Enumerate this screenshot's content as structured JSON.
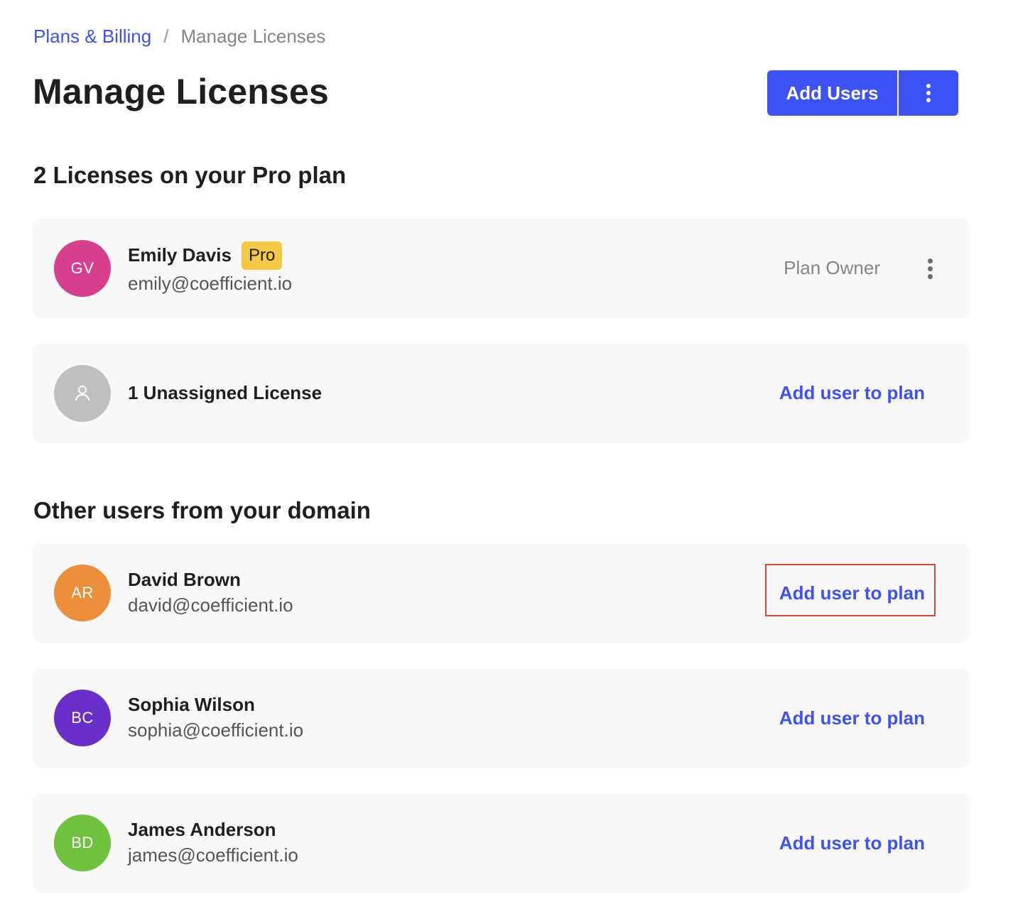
{
  "breadcrumb": {
    "parent": "Plans & Billing",
    "separator": "/",
    "current": "Manage Licenses"
  },
  "header": {
    "title": "Manage Licenses",
    "primary_button": "Add Users"
  },
  "licenses_section": {
    "title": "2 Licenses on your Pro plan",
    "owner": {
      "initials": "GV",
      "name": "Emily Davis",
      "badge": "Pro",
      "email": "emily@coefficient.io",
      "role": "Plan Owner",
      "avatar_color": "#d83f8c"
    },
    "unassigned": {
      "label": "1 Unassigned License",
      "action": "Add user to plan",
      "avatar_color": "#bfbfbf"
    }
  },
  "domain_section": {
    "title": "Other users from your domain",
    "users": [
      {
        "initials": "AR",
        "name": "David Brown",
        "email": "david@coefficient.io",
        "action": "Add user to plan",
        "avatar_color": "#ec8f3a"
      },
      {
        "initials": "BC",
        "name": "Sophia Wilson",
        "email": "sophia@coefficient.io",
        "action": "Add user to plan",
        "avatar_color": "#6b2fc9"
      },
      {
        "initials": "BD",
        "name": "James Anderson",
        "email": "james@coefficient.io",
        "action": "Add user to plan",
        "avatar_color": "#6fc23d"
      }
    ]
  },
  "colors": {
    "accent": "#3d52f5",
    "link": "#3d52f0",
    "badge": "#f3c946",
    "highlight": "#e0472f"
  }
}
